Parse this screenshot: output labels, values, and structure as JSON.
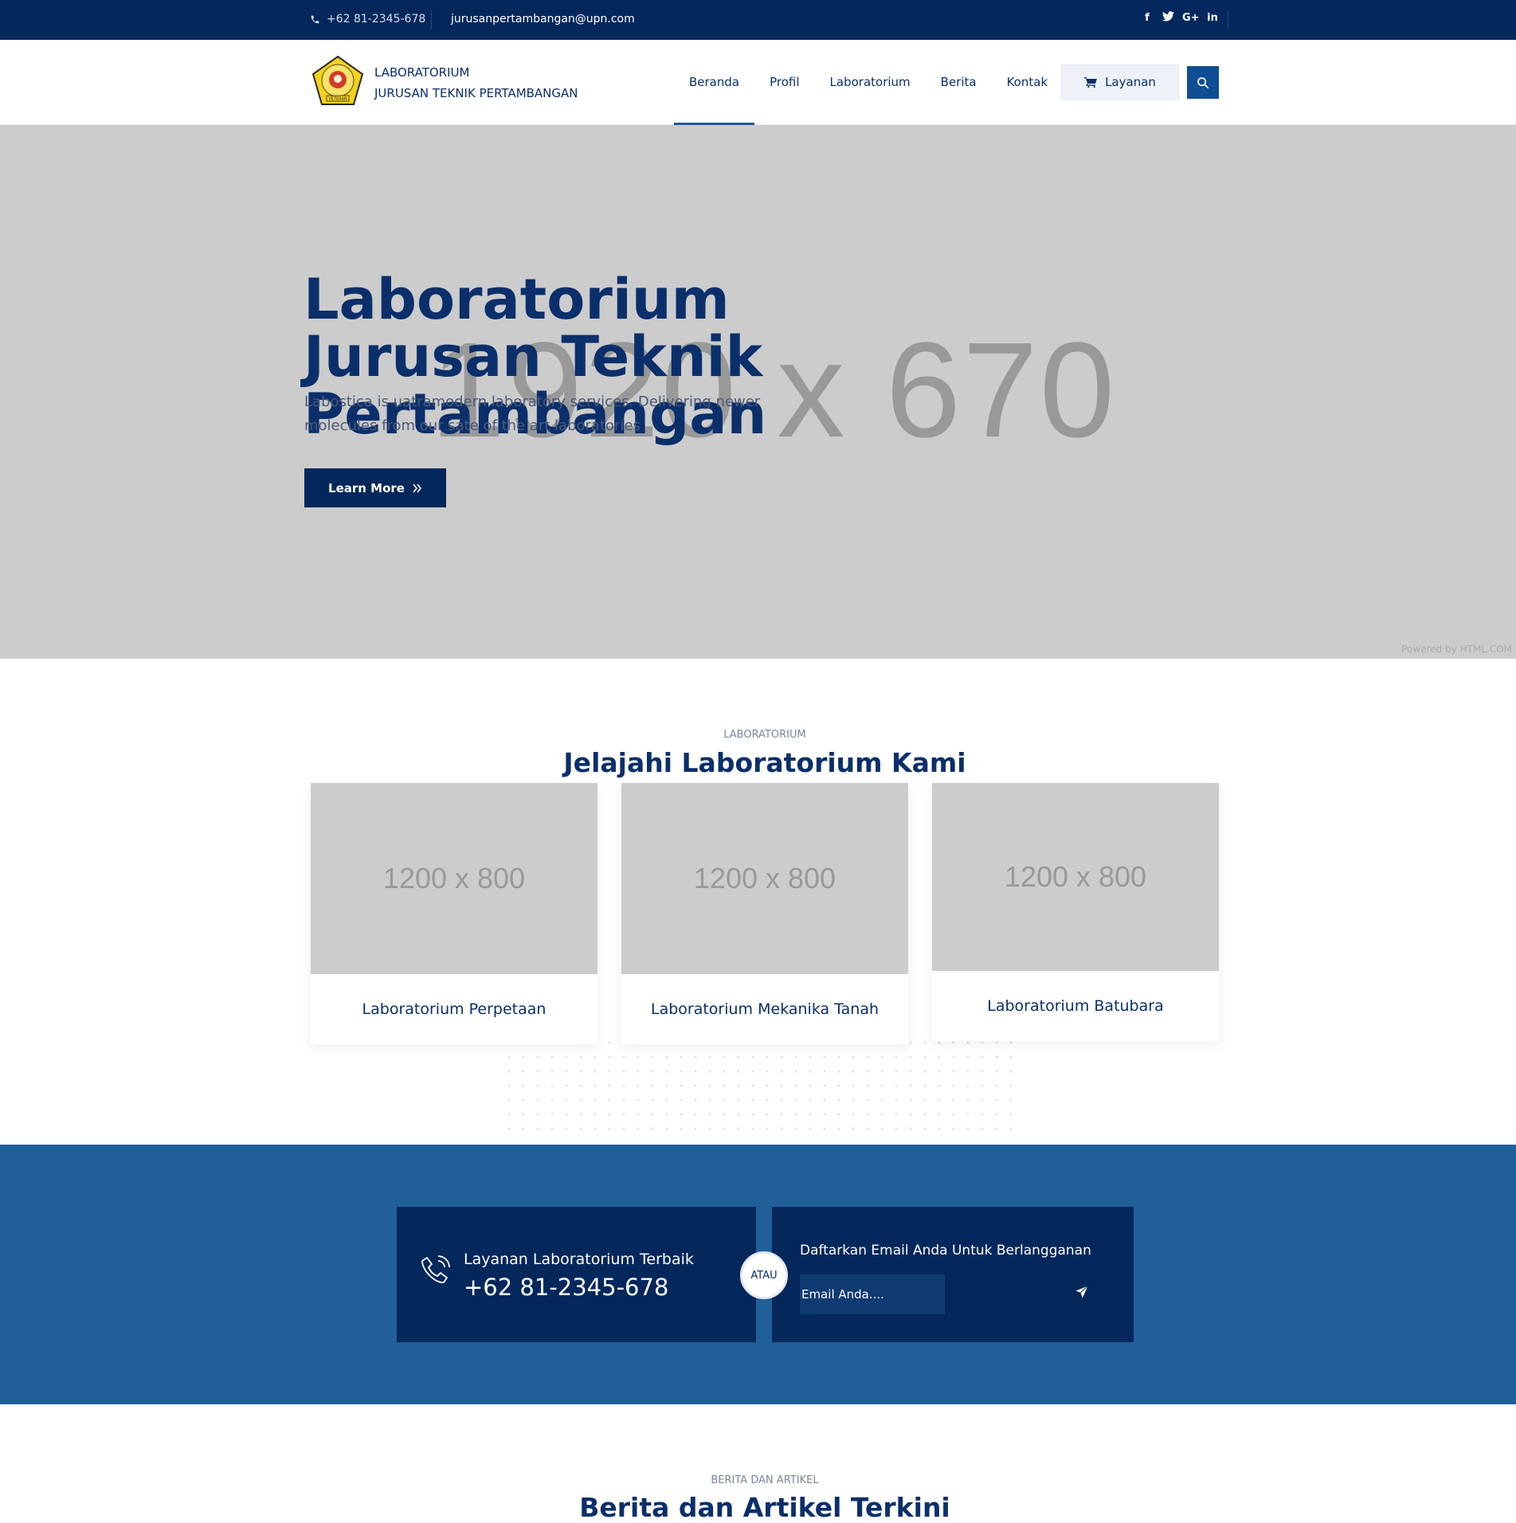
{
  "topbar": {
    "phone": "+62 81-2345-678",
    "email": "jurusanpertambangan@upn.com",
    "socials": [
      "facebook-icon",
      "twitter-icon",
      "google-plus-icon",
      "linkedin-icon"
    ]
  },
  "header": {
    "brand_line1": "LABORATORIUM",
    "brand_line2": "JURUSAN TEKNIK PERTAMBANGAN",
    "logo_text": "VETERAN",
    "nav": [
      {
        "label": "Beranda",
        "active": true
      },
      {
        "label": "Profil"
      },
      {
        "label": "Laboratorium"
      },
      {
        "label": "Berita"
      },
      {
        "label": "Kontak"
      }
    ],
    "cta_label": "Layanan"
  },
  "hero": {
    "placeholder": "1920 x 670",
    "title": "Laboratorium Jurusan Teknik Pertambangan",
    "description": "Labostica is uatramodern laboratory services. Delivering newer molecules from our sate of the art laboratories",
    "button": "Learn More",
    "powered": "Powered by HTML.COM"
  },
  "labs": {
    "subtitle": "LABORATORIUM",
    "title": "Jelajahi Laboratorium Kami",
    "items": [
      {
        "placeholder": "1200 x 800",
        "label": "Laboratorium Perpetaan"
      },
      {
        "placeholder": "1200 x 800",
        "label": "Laboratorium Mekanika Tanah"
      },
      {
        "placeholder": "1200 x 800",
        "label": "Laboratorium Batubara"
      }
    ]
  },
  "contact": {
    "service_title": "Layanan Laboratorium Terbaik",
    "service_phone": "+62 81-2345-678",
    "or_label": "ATAU",
    "subscribe_title": "Daftarkan Email Anda Untuk Berlangganan",
    "email_placeholder": "Email Anda...."
  },
  "news": {
    "subtitle": "BERITA DAN ARTIKEL",
    "title": "Berita dan Artikel Terkini"
  },
  "colors": {
    "navy": "#04285c",
    "brand_blue": "#0b2f6b",
    "band_blue": "#215f98",
    "placeholder_gray": "#cccccc"
  }
}
